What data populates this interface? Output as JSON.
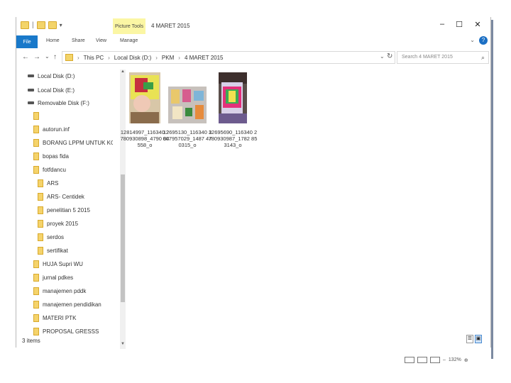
{
  "window": {
    "title": "4 MARET 2015",
    "contextual_tab": "Picture Tools",
    "controls": {
      "minimize": "–",
      "maximize": "☐",
      "close": "✕"
    }
  },
  "ribbon": {
    "tabs": [
      "File",
      "Home",
      "Share",
      "View",
      "Manage"
    ],
    "help": "?",
    "collapse": "⌄"
  },
  "address": {
    "back": "←",
    "forward": "→",
    "recent": "⌄",
    "up": "↑",
    "crumbs": [
      "This PC",
      "Local Disk (D:)",
      "PKM",
      "4 MARET 2015"
    ],
    "dropdown": "⌄",
    "refresh": "↻"
  },
  "search": {
    "placeholder": "Search 4 MARET 2015",
    "icon": "search-icon"
  },
  "nav_items": [
    {
      "label": "Local Disk (D:)",
      "type": "drive",
      "selected": true
    },
    {
      "label": "Local Disk (E:)",
      "type": "drive"
    },
    {
      "label": "Removable Disk (F:)",
      "type": "drive"
    },
    {
      "label": "",
      "type": "folder"
    },
    {
      "label": "autorun.inf",
      "type": "folder"
    },
    {
      "label": "BORANG LPPM UNTUK KOP",
      "type": "folder"
    },
    {
      "label": "bopas fida",
      "type": "folder"
    },
    {
      "label": "fotfdancu",
      "type": "folder"
    },
    {
      "label": "ARS",
      "type": "folder"
    },
    {
      "label": "ARS- Centidek",
      "type": "folder"
    },
    {
      "label": "penelitian 5 2015",
      "type": "folder"
    },
    {
      "label": "proyek 2015",
      "type": "folder"
    },
    {
      "label": "serdos",
      "type": "folder"
    },
    {
      "label": "sertifikat",
      "type": "folder"
    },
    {
      "label": "HUJA Supri WU",
      "type": "folder"
    },
    {
      "label": "jurnal pdkes",
      "type": "folder"
    },
    {
      "label": "manajemen pddk",
      "type": "folder"
    },
    {
      "label": "manajemen pendidikan",
      "type": "folder"
    },
    {
      "label": "MATERI PTK",
      "type": "folder"
    },
    {
      "label": "PROPOSAL GRESSS",
      "type": "folder"
    }
  ],
  "files": [
    {
      "name": "12814997_116340 2780930898_4790 84558_o"
    },
    {
      "name": "12695130_116340 3007957029_1487 470315_o"
    },
    {
      "name": "12695690_116340 2780930987_1782 853143_o"
    }
  ],
  "status": {
    "items": "3 items"
  },
  "bottom": {
    "zoom": "132%"
  },
  "colors": {
    "accent": "#1979ca",
    "context_tab": "#fbf6a4",
    "folder": "#f5d36b"
  }
}
